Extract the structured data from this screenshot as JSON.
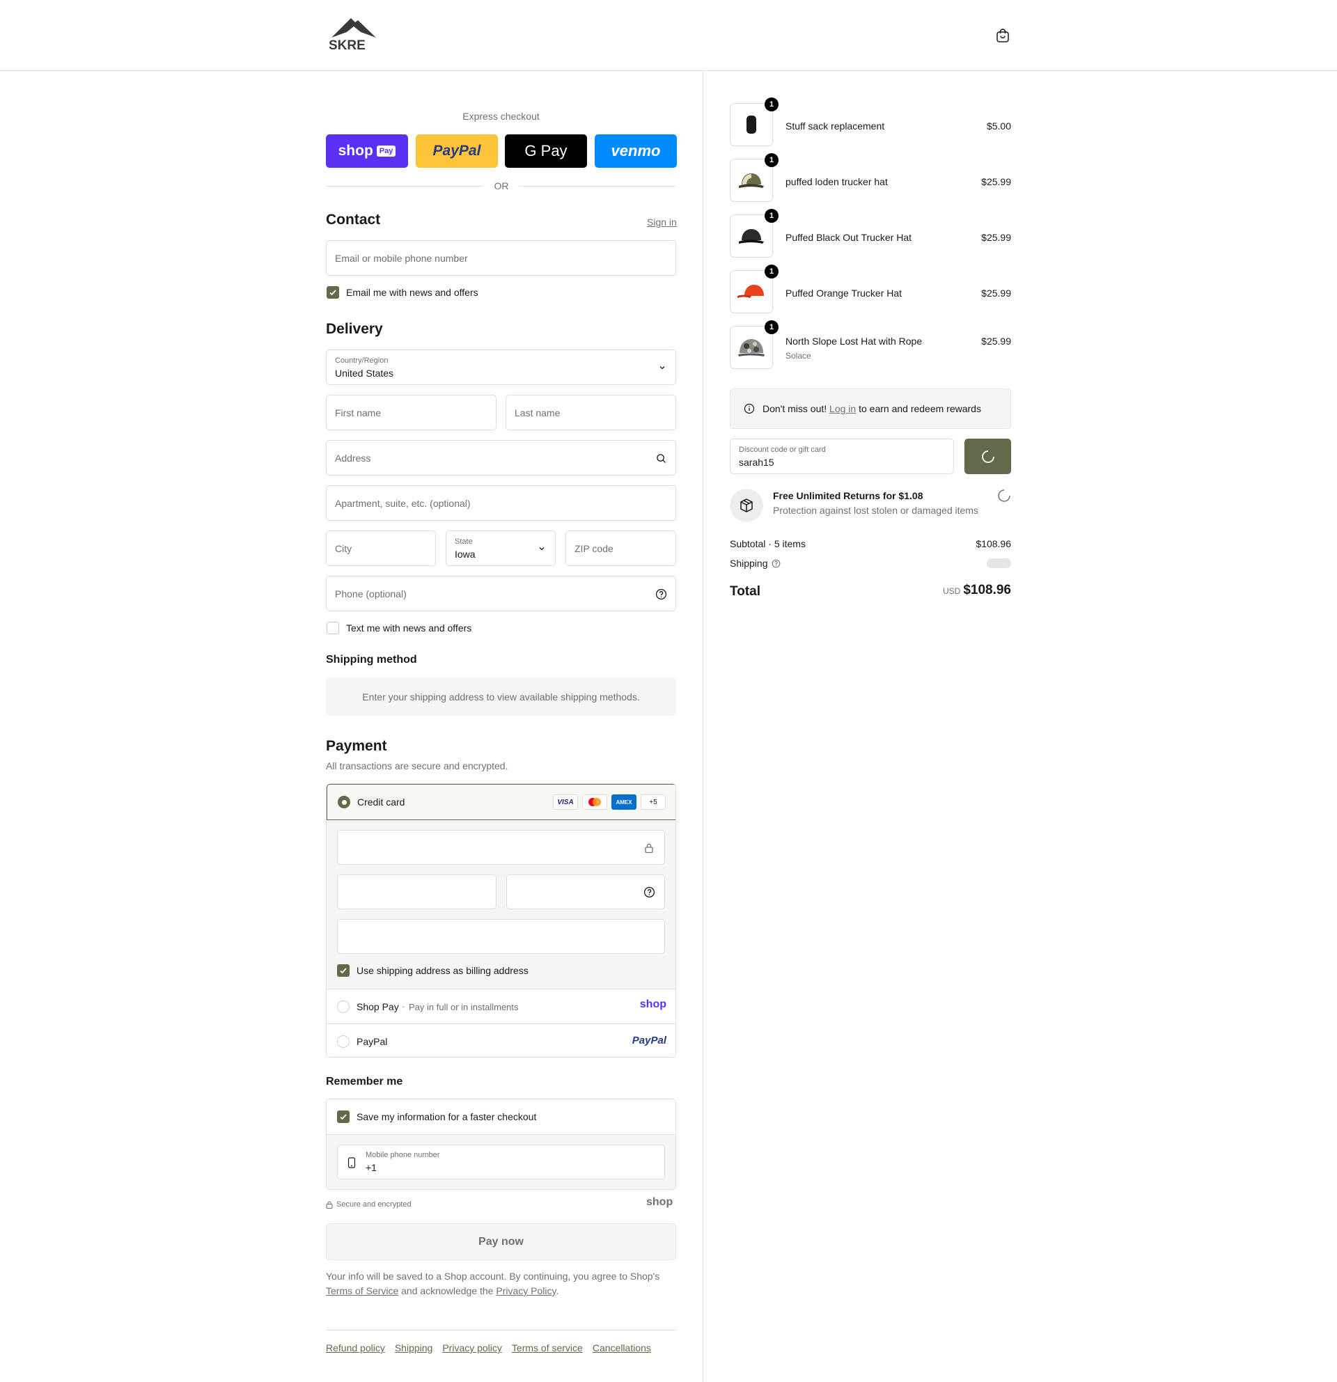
{
  "header": {
    "brand": "SKRE"
  },
  "express": {
    "label": "Express checkout",
    "buttons": [
      {
        "label": "shop",
        "badge": "Pay",
        "color": "#5a31f4"
      },
      {
        "label": "PayPal",
        "color": "#ffc439"
      },
      {
        "label": "G Pay",
        "color": "#000000"
      },
      {
        "label": "venmo",
        "color": "#008cff"
      }
    ],
    "or": "OR"
  },
  "contact": {
    "title": "Contact",
    "sign_in": "Sign in",
    "email_placeholder": "Email or mobile phone number",
    "email_news": "Email me with news and offers",
    "email_news_checked": true
  },
  "delivery": {
    "title": "Delivery",
    "country_label": "Country/Region",
    "country_value": "United States",
    "first_name": "First name",
    "last_name": "Last name",
    "address": "Address",
    "apartment": "Apartment, suite, etc. (optional)",
    "city": "City",
    "state_label": "State",
    "state_value": "Iowa",
    "zip": "ZIP code",
    "phone": "Phone (optional)",
    "text_news": "Text me with news and offers",
    "text_news_checked": false
  },
  "shipping_method": {
    "title": "Shipping method",
    "message": "Enter your shipping address to view available shipping methods."
  },
  "payment": {
    "title": "Payment",
    "subtitle": "All transactions are secure and encrypted.",
    "credit_card": "Credit card",
    "card_brands": [
      "VISA",
      "Mastercard",
      "AMEX",
      "+5"
    ],
    "billing_same": "Use shipping address as billing address",
    "shop_pay": "Shop Pay",
    "shop_pay_desc": "Pay in full or in installments",
    "shop_logo": "shop",
    "paypal": "PayPal",
    "paypal_logo": "PayPal"
  },
  "remember": {
    "title": "Remember me",
    "save_info": "Save my information for a faster checkout",
    "mobile_label": "Mobile phone number",
    "mobile_value": "+1",
    "secure": "Secure and encrypted",
    "shop_logo": "shop"
  },
  "pay_now": "Pay now",
  "legal": {
    "text1": "Your info will be saved to a Shop account. By continuing, you agree to Shop's",
    "terms": "Terms of Service",
    "text2": "and acknowledge the",
    "privacy": "Privacy Policy",
    "end": "."
  },
  "footer": [
    "Refund policy",
    "Shipping",
    "Privacy policy",
    "Terms of service",
    "Cancellations"
  ],
  "cart": {
    "items": [
      {
        "name": "Stuff sack replacement",
        "price": "$5.00",
        "qty": "1",
        "variant": ""
      },
      {
        "name": "puffed loden trucker hat",
        "price": "$25.99",
        "qty": "1",
        "variant": ""
      },
      {
        "name": "Puffed Black Out Trucker Hat",
        "price": "$25.99",
        "qty": "1",
        "variant": ""
      },
      {
        "name": "Puffed Orange Trucker Hat",
        "price": "$25.99",
        "qty": "1",
        "variant": ""
      },
      {
        "name": "North Slope Lost Hat with Rope",
        "price": "$25.99",
        "qty": "1",
        "variant": "Solace"
      }
    ],
    "rewards_pre": "Don't miss out!",
    "rewards_link": "Log in",
    "rewards_post": "to earn and redeem rewards",
    "discount_label": "Discount code or gift card",
    "discount_value": "sarah15",
    "returns_title": "Free Unlimited Returns for $1.08",
    "returns_desc": "Protection against lost stolen or damaged items",
    "subtotal_label": "Subtotal · 5 items",
    "subtotal_value": "$108.96",
    "shipping_label": "Shipping",
    "total_label": "Total",
    "currency": "USD",
    "total_value": "$108.96"
  },
  "colors": {
    "accent": "#616b4c",
    "border": "#dedede",
    "muted": "#707070"
  }
}
